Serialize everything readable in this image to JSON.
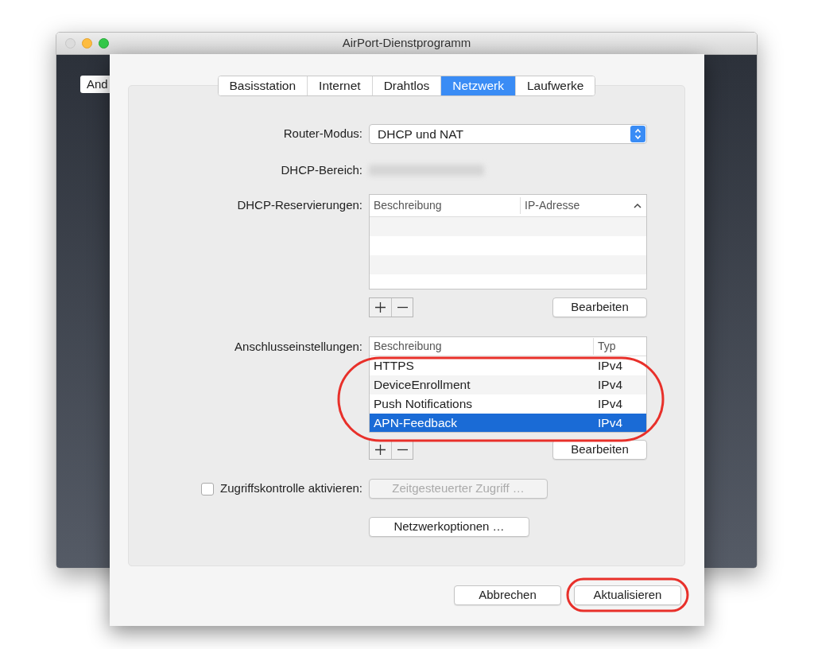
{
  "window": {
    "title": "AirPort-Dienstprogramm"
  },
  "background_button": "And",
  "tabs": [
    {
      "label": "Basisstation",
      "selected": false
    },
    {
      "label": "Internet",
      "selected": false
    },
    {
      "label": "Drahtlos",
      "selected": false
    },
    {
      "label": "Netzwerk",
      "selected": true
    },
    {
      "label": "Laufwerke",
      "selected": false
    }
  ],
  "router_mode": {
    "label": "Router-Modus:",
    "value": "DHCP und NAT"
  },
  "dhcp_range": {
    "label": "DHCP-Bereich:"
  },
  "dhcp_reservations": {
    "label": "DHCP-Reservierungen:",
    "columns": [
      "Beschreibung",
      "IP-Adresse"
    ],
    "edit_button": "Bearbeiten"
  },
  "port_settings": {
    "label": "Anschlusseinstellungen:",
    "columns": [
      "Beschreibung",
      "Typ"
    ],
    "rows": [
      {
        "description": "HTTPS",
        "type": "IPv4",
        "selected": false
      },
      {
        "description": "DeviceEnrollment",
        "type": "IPv4",
        "selected": false
      },
      {
        "description": "Push Notifications",
        "type": "IPv4",
        "selected": false
      },
      {
        "description": "APN-Feedback",
        "type": "IPv4",
        "selected": true
      }
    ],
    "edit_button": "Bearbeiten"
  },
  "access_control": {
    "label": "Zugriffskontrolle aktivieren:",
    "checked": false,
    "button": {
      "label": "Zeitgesteuerter Zugriff …",
      "disabled": true
    }
  },
  "network_options_button": "Netzwerkoptionen …",
  "footer_buttons": [
    "Abbrechen",
    "Aktualisieren"
  ]
}
